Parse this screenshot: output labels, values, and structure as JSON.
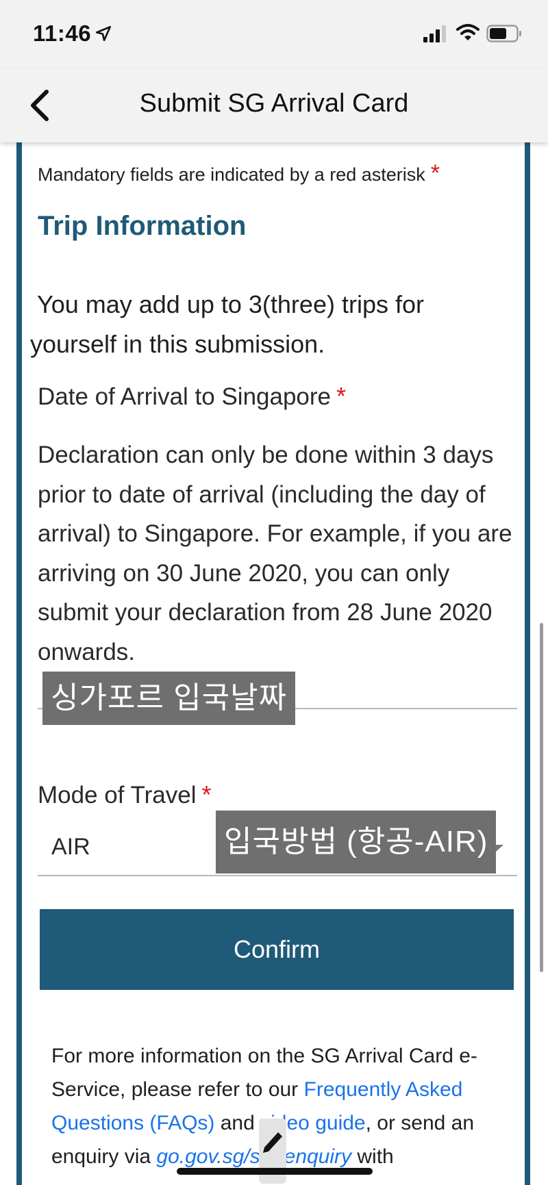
{
  "status_bar": {
    "time": "11:46",
    "icons": [
      "location-arrow-icon",
      "signal-icon",
      "wifi-icon",
      "battery-icon"
    ]
  },
  "nav": {
    "back_icon": "chevron-left-icon",
    "title": "Submit SG Arrival Card"
  },
  "form": {
    "mandatory_note": "Mandatory fields are indicated by a red asterisk",
    "asterisk": "*",
    "section_title": "Trip Information",
    "trip_note": "You may add up to 3(three) trips for yourself in this submission.",
    "date_label": "Date of Arrival to Singapore",
    "declaration": "Declaration can only be done within 3 days prior to date of arrival (including the day of arrival) to Singapore. For example, if you are arriving on 30 June 2020, you can only submit your declaration from 28 June 2020 onwards.",
    "date_value": "",
    "date_overlay": "싱가포르 입국날짜",
    "mode_label": "Mode of Travel",
    "mode_value": "AIR",
    "mode_overlay": "입국방법 (항공-AIR)",
    "confirm_label": "Confirm"
  },
  "info": {
    "part1": "For more information on the SG Arrival Card e-Service, please refer to our ",
    "faq_link": "Frequently Asked Questions (FAQs)",
    "part2": " and ",
    "video_link": "video guide",
    "part3": ", or send an enquiry via ",
    "enquiry_link": "go.gov.sg/sto-enquiry",
    "part4": " with"
  },
  "colors": {
    "brand": "#1f5a78",
    "asterisk": "#e0141e",
    "link": "#1a73e8"
  }
}
